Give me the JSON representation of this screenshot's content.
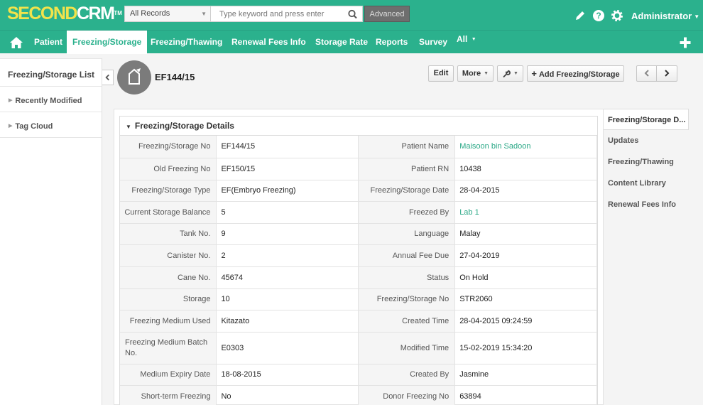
{
  "app": {
    "logo_part1": "SECOND",
    "logo_part2": "CRM",
    "logo_tm": "TM"
  },
  "search": {
    "scope": "All Records",
    "placeholder": "Type keyword and press enter",
    "value": "",
    "advanced_label": "Advanced"
  },
  "user": {
    "name": "Administrator"
  },
  "nav": {
    "items": [
      {
        "label": "Patient"
      },
      {
        "label": "Freezing/Storage"
      },
      {
        "label": "Freezing/Thawing"
      },
      {
        "label": "Renewal Fees Info"
      },
      {
        "label": "Storage Rate"
      },
      {
        "label": "Reports"
      },
      {
        "label": "Survey"
      },
      {
        "label": "All"
      }
    ]
  },
  "sidebar": {
    "title": "Freezing/Storage List",
    "links": [
      {
        "label": "Recently Modified"
      },
      {
        "label": "Tag Cloud"
      }
    ]
  },
  "record": {
    "title": "EF144/15",
    "buttons": {
      "edit": "Edit",
      "more": "More",
      "add": "Add Freezing/Storage"
    }
  },
  "details": {
    "heading": "Freezing/Storage Details",
    "rows": [
      {
        "l1": "Freezing/Storage No",
        "v1": "EF144/15",
        "l2": "Patient Name",
        "v2": "Maisoon bin Sadoon"
      },
      {
        "l1": "Old Freezing No",
        "v1": "EF150/15",
        "l2": "Patient RN",
        "v2": "10438"
      },
      {
        "l1": "Freezing/Storage Type",
        "v1": "EF(Embryo Freezing)",
        "l2": "Freezing/Storage Date",
        "v2": "28-04-2015"
      },
      {
        "l1": "Current Storage Balance",
        "v1": "5",
        "l2": "Freezed By",
        "v2": "Lab 1"
      },
      {
        "l1": "Tank No.",
        "v1": "9",
        "l2": "Language",
        "v2": "Malay"
      },
      {
        "l1": "Canister No.",
        "v1": "2",
        "l2": "Annual Fee Due",
        "v2": "27-04-2019"
      },
      {
        "l1": "Cane No.",
        "v1": "45674",
        "l2": "Status",
        "v2": "On Hold"
      },
      {
        "l1": "Storage",
        "v1": "10",
        "l2": "Freezing/Storage No",
        "v2": "STR2060"
      },
      {
        "l1": "Freezing Medium Used",
        "v1": "Kitazato",
        "l2": "Created Time",
        "v2": "28-04-2015 09:24:59"
      },
      {
        "l1": "Freezing Medium Batch No.",
        "v1": "E0303",
        "l2": "Modified Time",
        "v2": "15-02-2019 15:34:20"
      },
      {
        "l1": "Medium Expiry Date",
        "v1": "18-08-2015",
        "l2": "Created By",
        "v2": "Jasmine"
      },
      {
        "l1": "Short-term Freezing",
        "v1": "No",
        "l2": "Donor Freezing No",
        "v2": "63894"
      }
    ]
  },
  "related": {
    "items": [
      {
        "label": "Freezing/Storage D..."
      },
      {
        "label": "Updates"
      },
      {
        "label": "Freezing/Thawing"
      },
      {
        "label": "Content Library"
      },
      {
        "label": "Renewal Fees Info"
      }
    ]
  },
  "colors": {
    "brand": "#2bb18d",
    "logo_accent": "#f2e34b",
    "link": "#2aa886"
  }
}
